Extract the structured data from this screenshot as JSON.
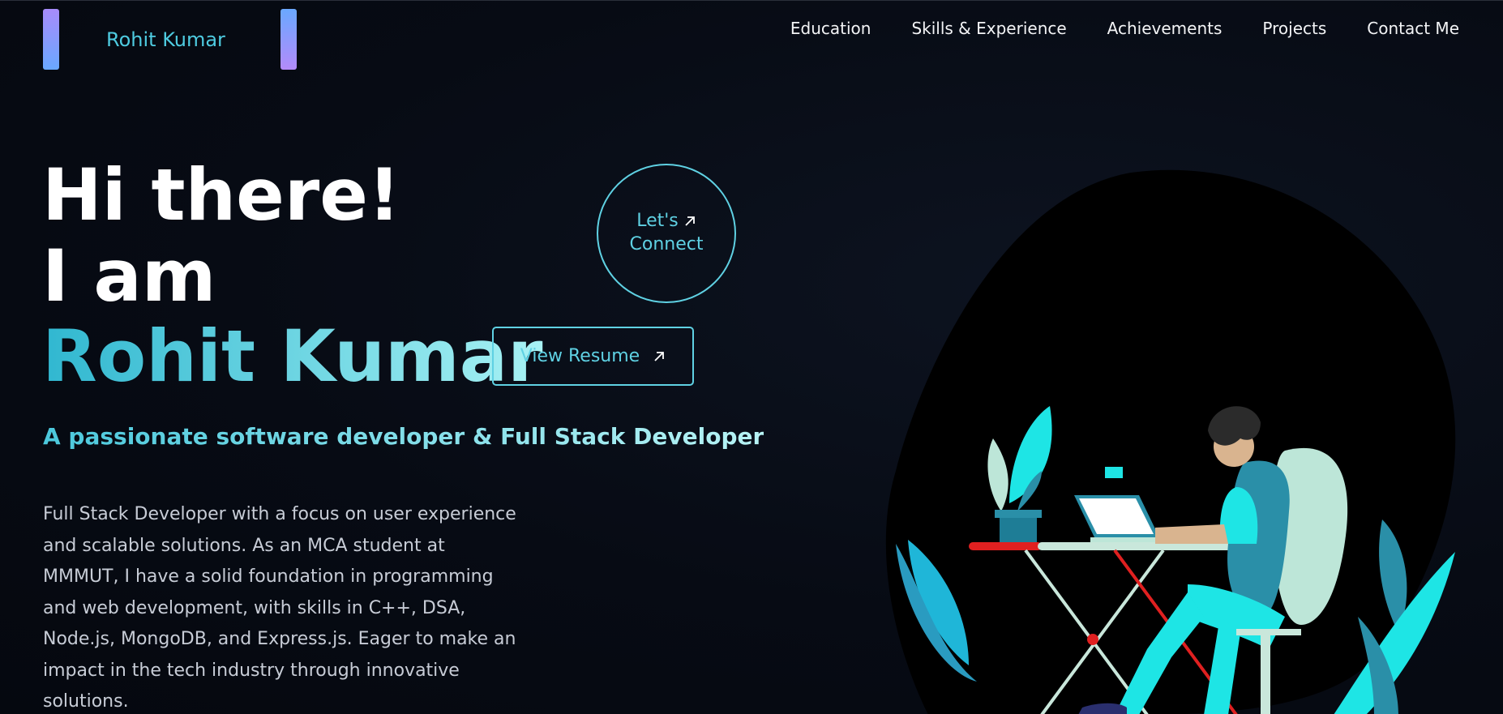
{
  "nav": {
    "logo_text": "Rohit Kumar",
    "links": [
      "Education",
      "Skills & Experience",
      "Achievements",
      "Projects",
      "Contact Me"
    ]
  },
  "hero": {
    "line1": "Hi there!",
    "line2": "I am",
    "name": "Rohit Kumar",
    "connect_line1": "Let's",
    "connect_line2": "Connect",
    "resume_label": "View Resume",
    "tagline": "A passionate software developer & Full Stack Developer",
    "bio": "Full Stack Developer with a focus on user experience and scalable solutions. As an MCA student at MMMUT, I have a solid foundation in programming and web development, with skills in C++, DSA, Node.js, MongoDB, and Express.js. Eager to make an impact in the tech industry through innovative solutions."
  },
  "colors": {
    "accent": "#5fd1e3",
    "background": "#070b14",
    "logo_gradient_start": "#a78bfa",
    "logo_gradient_end": "#6aa8ff"
  },
  "icons": {
    "connect": "arrow-up-right-icon",
    "resume": "arrow-up-right-icon"
  }
}
